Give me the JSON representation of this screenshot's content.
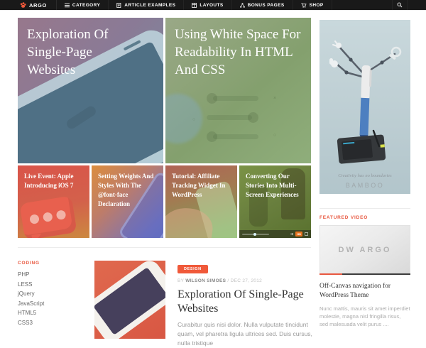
{
  "nav": {
    "logo": "ARGO",
    "items": [
      {
        "label": "CATEGORY",
        "icon": "hamburger-icon"
      },
      {
        "label": "ARTICLE EXAMPLES",
        "icon": "article-icon"
      },
      {
        "label": "LAYOUTS",
        "icon": "layouts-icon"
      },
      {
        "label": "BONUS PAGES",
        "icon": "sitemap-icon"
      },
      {
        "label": "SHOP",
        "icon": "cart-icon"
      }
    ]
  },
  "hero": [
    {
      "title": "Exploration Of Single-Page Websites",
      "overlay": "#8a7a96"
    },
    {
      "title": "Using White Space For Readability In HTML And CSS",
      "overlay": "#84a06e"
    }
  ],
  "tiles": [
    {
      "title": "Live Event: Apple Introducing iOS 7",
      "overlay": "#d9544a"
    },
    {
      "title": "Setting Weights And Styles With The @font-face Declaration",
      "overlay": "#bd7c6a"
    },
    {
      "title": "Tutorial: Affiliate Tracking Widget In WordPress",
      "overlay": "#a37a52"
    },
    {
      "title": "Converting Our Stories Into Multi-Screen Experiences",
      "overlay": "#697f3e",
      "player": {
        "hd_label": "HD"
      }
    }
  ],
  "coding_widget": {
    "title": "CODING",
    "items": [
      "PHP",
      "LESS",
      "jQuery",
      "JavaScript",
      "HTML5",
      "CSS3"
    ]
  },
  "article": {
    "category_badge": "DESIGN",
    "byline_prefix": "BY",
    "author": "WILSON SIMOES",
    "meta_separator": "/",
    "date": "DEC 27, 2012",
    "title": "Exploration Of Single-Page Websites",
    "excerpt": "Curabitur quis nisi dolor. Nulla vulputate tincidunt quam, vel pharetra ligula ultrices sed. Duis cursus, nulla tristique"
  },
  "sidebar": {
    "ad": {
      "tagline": "Creativity has no boundaries",
      "brand": "BAMBOO"
    },
    "featured_video": {
      "heading": "FEATURED VIDEO",
      "video_label": "DW ARGO",
      "title": "Off-Canvas navigation for WordPress Theme",
      "excerpt": "Nunc mattis, mauris sit amet imperdiet molestie, magna nisl fringilla risus, sed malesuada velit purus ...."
    }
  },
  "colors": {
    "accent": "#f0593a",
    "nav_bg": "#191919",
    "heading_red": "#e8573f",
    "progress_red": "#e8573f",
    "progress_dark": "#3c3c3c"
  }
}
